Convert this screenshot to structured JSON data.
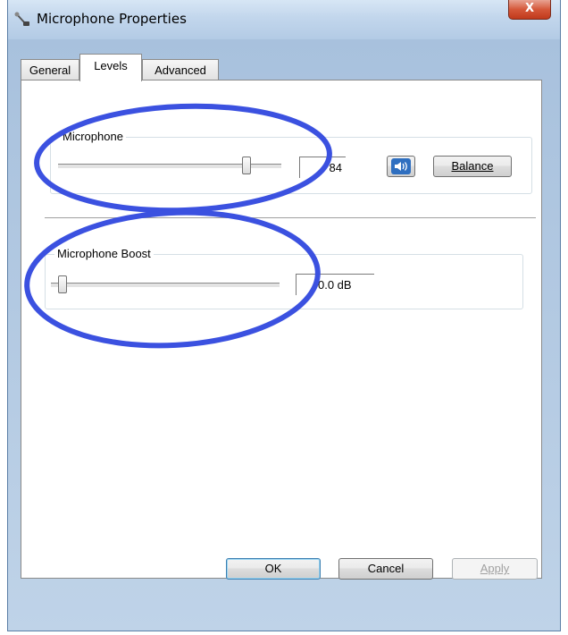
{
  "window": {
    "title": "Microphone Properties",
    "close_glyph": "X"
  },
  "tabs": [
    {
      "label": "General",
      "active": false
    },
    {
      "label": "Levels",
      "active": true
    },
    {
      "label": "Advanced",
      "active": false
    }
  ],
  "levels": {
    "microphone": {
      "group_label": "Microphone",
      "level": 84,
      "value_text": "84",
      "speaker_icon": "speaker-icon",
      "balance_label": "Balance"
    },
    "boost": {
      "group_label": "Microphone Boost",
      "level": 0,
      "value_text": "0.0 dB"
    }
  },
  "buttons": {
    "ok": "OK",
    "cancel": "Cancel",
    "apply": "Apply"
  },
  "colors": {
    "annotation": "#3b51e0",
    "close_button": "#c8432a"
  }
}
